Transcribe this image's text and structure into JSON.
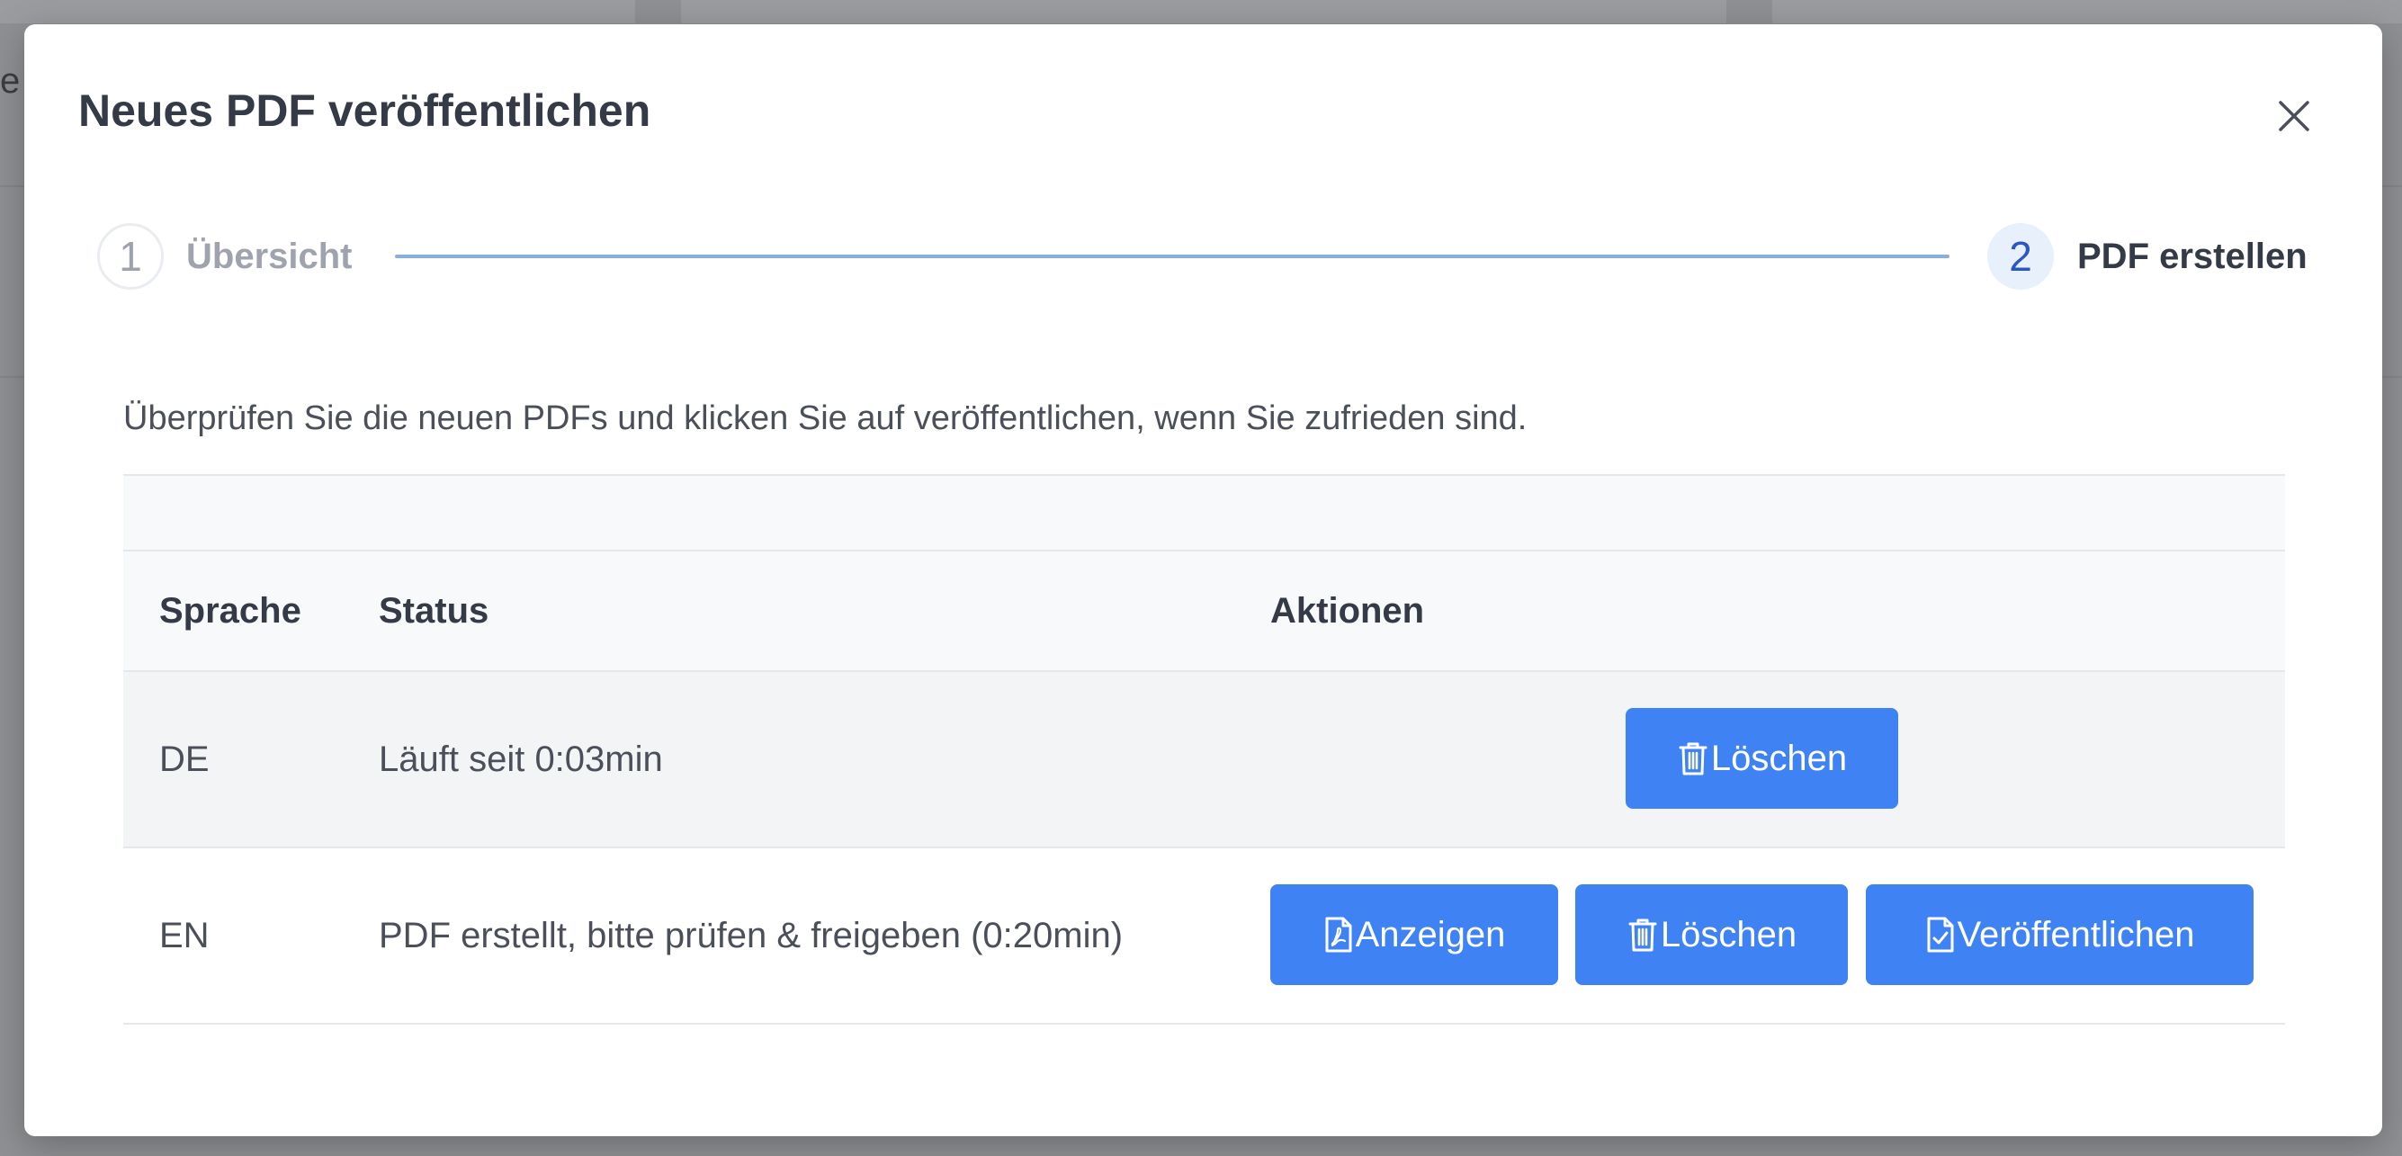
{
  "background": {
    "partial_text": "e"
  },
  "modal": {
    "title": "Neues PDF veröffentlichen",
    "close_icon": "close-icon"
  },
  "stepper": {
    "steps": [
      {
        "number": "1",
        "label": "Übersicht",
        "state": "completed"
      },
      {
        "number": "2",
        "label": "PDF erstellen",
        "state": "active"
      }
    ]
  },
  "intro_text": "Überprüfen Sie die neuen PDFs und klicken Sie auf veröffentlichen, wenn Sie zufrieden sind.",
  "table": {
    "headers": {
      "language": "Sprache",
      "status": "Status",
      "actions": "Aktionen"
    },
    "rows": [
      {
        "language": "DE",
        "status": "Läuft seit 0:03min",
        "actions": [
          {
            "label": "Löschen",
            "icon": "trash-icon"
          }
        ]
      },
      {
        "language": "EN",
        "status": "PDF erstellt, bitte prüfen & freigeben (0:20min)",
        "actions": [
          {
            "label": "Anzeigen",
            "icon": "pdf-file-icon"
          },
          {
            "label": "Löschen",
            "icon": "trash-icon"
          },
          {
            "label": "Veröffentlichen",
            "icon": "file-check-icon"
          }
        ]
      }
    ]
  },
  "colors": {
    "primary_button": "#3f82f4",
    "overlay": "#8f9093",
    "active_step_bg": "#e8f0fb",
    "active_step_text": "#2b56c8",
    "connector": "#86aeea"
  }
}
